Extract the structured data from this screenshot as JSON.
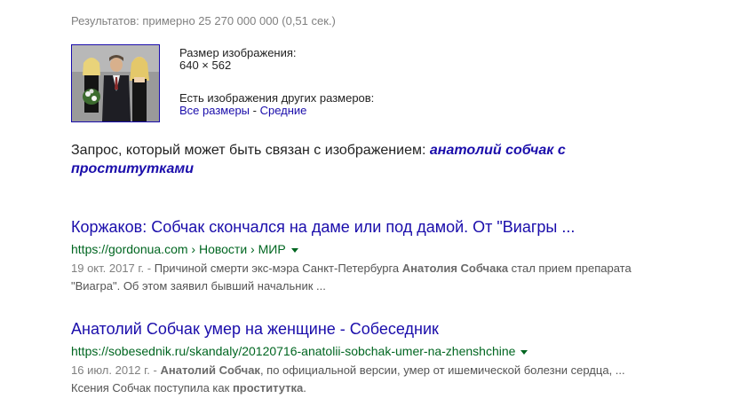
{
  "stats": {
    "text": "Результатов: примерно 25 270 000 000 (0,51 сек.)"
  },
  "image_info": {
    "size_label": "Размер изображения:",
    "size_value": "640 × 562",
    "other_sizes_label": "Есть изображения других размеров:",
    "all_sizes_link": "Все размеры",
    "separator": " - ",
    "medium_link": "Средние"
  },
  "related_query": {
    "prefix": "Запрос, который может быть связан с изображением: ",
    "link": "анатолий собчак с проститутками"
  },
  "results": [
    {
      "title": "Коржаков: Собчак скончался на даме или под дамой. От \"Виагры ...",
      "url": "https://gordonua.com › Новости › МИР",
      "date": "19 окт. 2017 г. - ",
      "snippet_1": "Причиной смерти экс-мэра Санкт-Петербурга ",
      "snippet_bold_1": "Анатолия Собчака",
      "snippet_2": " стал прием препарата \"Виагра\". Об этом заявил бывший начальник ..."
    },
    {
      "title": "Анатолий Собчак умер на женщине - Собеседник",
      "url": "https://sobesednik.ru/skandaly/20120716-anatolii-sobchak-umer-na-zhenshchine",
      "date": "16 июл. 2012 г. - ",
      "snippet_bold_1": "Анатолий Собчак",
      "snippet_1": ", по официальной версии, умер от ишемической болезни сердца, ... Ксения Собчак поступила как ",
      "snippet_bold_2": "проститутка",
      "snippet_2": "."
    }
  ],
  "colors": {
    "link": "#1a0dab",
    "url_green": "#006621",
    "snippet": "#545454",
    "meta_gray": "#808080"
  }
}
